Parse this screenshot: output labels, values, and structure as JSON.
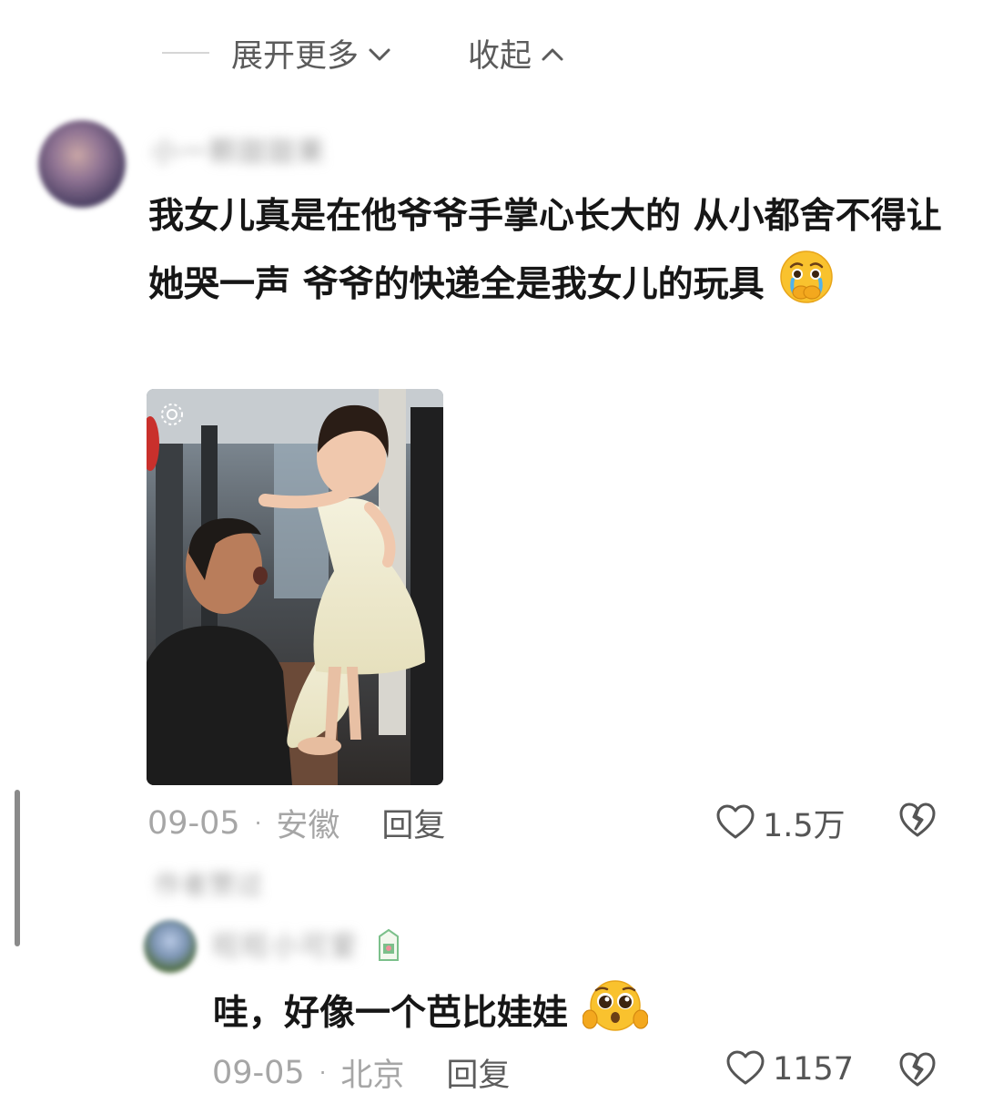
{
  "thread": {
    "expand_label": "展开更多",
    "collapse_label": "收起"
  },
  "comment": {
    "author": "小一颗甜甜果",
    "text": "我女儿真是在他爷爷手掌心长大的 从小都舍不得让她哭一声 爷爷的快递全是我女儿的玩具",
    "emoji": "crying-hand-over-mouth-emoji",
    "date": "09-05",
    "location": "安徽",
    "reply_label": "回复",
    "likes": "1.5万"
  },
  "author_replied_hint": "作者赞过",
  "reply": {
    "author": "旺旺小可爱",
    "text": "哇，好像一个芭比娃娃",
    "emoji": "pleading-face-emoji",
    "date": "09-05",
    "location": "北京",
    "reply_label": "回复",
    "likes": "1157"
  },
  "colors": {
    "text_primary": "#161616",
    "text_meta": "#a6a6a6",
    "reply_action": "#5c5c5c",
    "emoji_yellow": "#f9c22e"
  }
}
